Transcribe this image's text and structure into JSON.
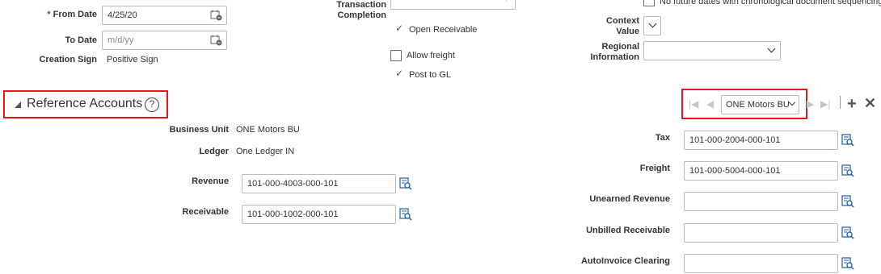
{
  "left": {
    "from_date": {
      "required": "*",
      "label": "From Date",
      "value": "4/25/20"
    },
    "to_date": {
      "label": "To Date",
      "placeholder": "m/d/yy"
    },
    "creation_sign": {
      "label": "Creation Sign",
      "value": "Positive Sign"
    }
  },
  "middle": {
    "transaction_completion_label": "Transaction Completion",
    "open_receivable": "Open Receivable",
    "allow_freight": "Allow freight",
    "post_to_gl": "Post to GL"
  },
  "right_top": {
    "no_future_dates": "No future dates with chronological document sequencing",
    "context_value_label": "Context Value",
    "regional_info_label": "Regional Information"
  },
  "reference_accounts": {
    "title": "Reference Accounts",
    "business_unit_label": "Business Unit",
    "business_unit_value": "ONE Motors BU",
    "ledger_label": "Ledger",
    "ledger_value": "One Ledger IN",
    "revenue_label": "Revenue",
    "revenue_value": "101-000-4003-000-101",
    "receivable_label": "Receivable",
    "receivable_value": "101-000-1002-000-101",
    "bu_selector_value": "ONE Motors BU",
    "tax_label": "Tax",
    "tax_value": "101-000-2004-000-101",
    "freight_label": "Freight",
    "freight_value": "101-000-5004-000-101",
    "unearned_label": "Unearned Revenue",
    "unbilled_label": "Unbilled Receivable",
    "autoinvoice_label": "AutoInvoice Clearing"
  },
  "colors": {
    "highlight": "#e8151b",
    "link_blue": "#1f5fa8"
  }
}
